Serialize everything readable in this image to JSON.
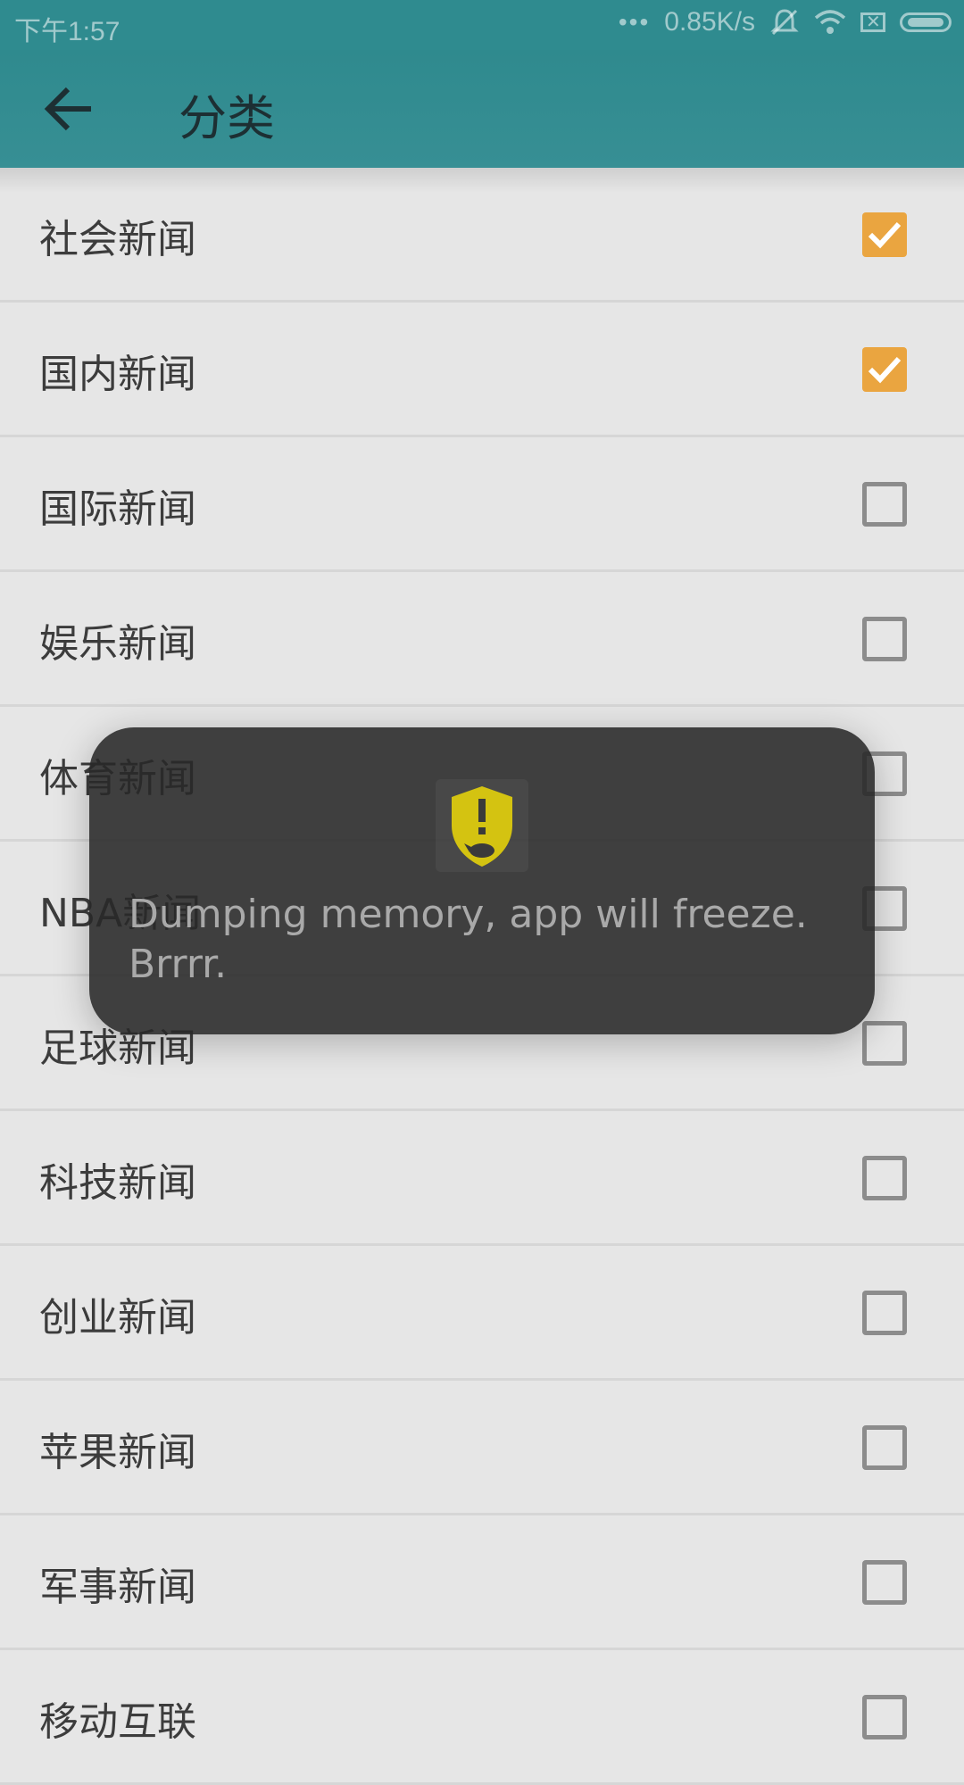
{
  "status_bar": {
    "time": "下午1:57",
    "dots": "•••",
    "net_speed": "0.85K/s",
    "icons": [
      "muted-bell-icon",
      "wifi-icon",
      "sim-x-icon",
      "battery-icon"
    ]
  },
  "app_bar": {
    "back_icon": "arrow-left-icon",
    "title": "分类"
  },
  "categories": [
    {
      "label": "社会新闻",
      "checked": true
    },
    {
      "label": "国内新闻",
      "checked": true
    },
    {
      "label": "国际新闻",
      "checked": false
    },
    {
      "label": "娱乐新闻",
      "checked": false
    },
    {
      "label": "体育新闻",
      "checked": false
    },
    {
      "label": "NBA新闻",
      "checked": false
    },
    {
      "label": "足球新闻",
      "checked": false
    },
    {
      "label": "科技新闻",
      "checked": false
    },
    {
      "label": "创业新闻",
      "checked": false
    },
    {
      "label": "苹果新闻",
      "checked": false
    },
    {
      "label": "军事新闻",
      "checked": false
    },
    {
      "label": "移动互联",
      "checked": false
    }
  ],
  "toast": {
    "icon": "leakcanary-shield-icon",
    "message": "Dumping memory, app will freeze. Brrrr."
  },
  "colors": {
    "app_bar": "#2f8b8f",
    "checkbox_checked": "#eaa540",
    "toast_icon": "#d4c311"
  }
}
